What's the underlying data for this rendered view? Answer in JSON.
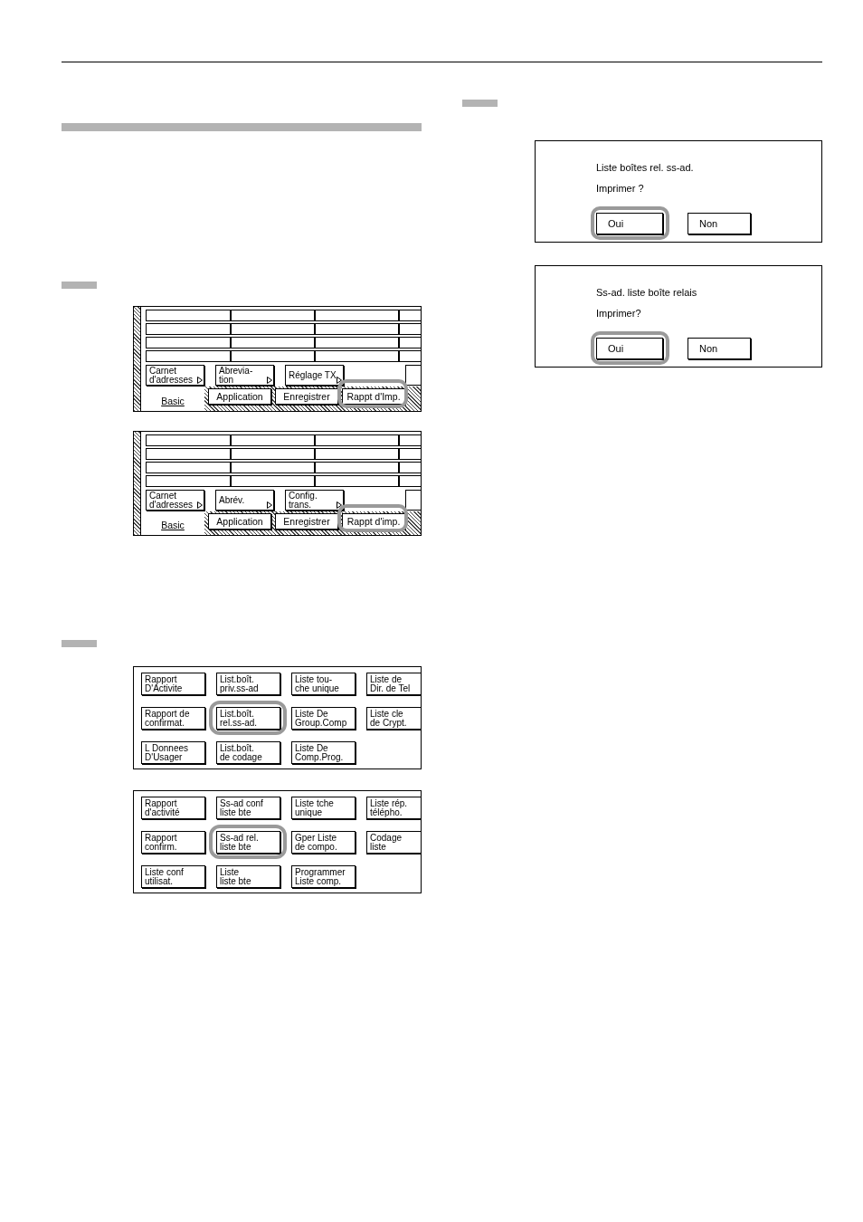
{
  "left_column": {
    "panels": [
      {
        "buttons": [
          {
            "kind": "menu",
            "label": "Carnet\nd'adresses"
          },
          {
            "kind": "menu",
            "label": "Abrevia-\ntion"
          },
          {
            "kind": "menu",
            "label": "Réglage TX"
          },
          {
            "kind": "clipped"
          }
        ],
        "tabs": [
          {
            "label": "Basic",
            "selected": true,
            "highlighted": false
          },
          {
            "label": "Application",
            "selected": false,
            "highlighted": false
          },
          {
            "label": "Enregistrer",
            "selected": false,
            "highlighted": false
          },
          {
            "label": "Rappt d'Imp.",
            "selected": false,
            "highlighted": true
          }
        ]
      },
      {
        "buttons": [
          {
            "kind": "menu",
            "label": "Carnet\nd'adresses"
          },
          {
            "kind": "menu",
            "label": "Abrév."
          },
          {
            "kind": "menu",
            "label": "Config.\ntrans."
          },
          {
            "kind": "clipped"
          }
        ],
        "tabs": [
          {
            "label": "Basic",
            "selected": true,
            "highlighted": false
          },
          {
            "label": "Application",
            "selected": false,
            "highlighted": false
          },
          {
            "label": "Enregistrer",
            "selected": false,
            "highlighted": false
          },
          {
            "label": "Rappt d'imp.",
            "selected": false,
            "highlighted": true
          }
        ]
      }
    ],
    "report_grids": [
      {
        "buttons": [
          {
            "label": "Rapport\nD'Activite",
            "highlighted": false
          },
          {
            "label": "List.boît.\npriv.ss-ad",
            "highlighted": false
          },
          {
            "label": "Liste tou-\nche unique",
            "highlighted": false
          },
          {
            "label": "Liste de\nDir. de Tel",
            "highlighted": false
          },
          {
            "label": "Rapport de\nconfirmat.",
            "highlighted": false
          },
          {
            "label": "List.boît.\nrel.ss-ad.",
            "highlighted": true
          },
          {
            "label": "Liste De\nGroup.Comp",
            "highlighted": false
          },
          {
            "label": "Liste cle\nde Crypt.",
            "highlighted": false
          },
          {
            "label": "L Donnees\nD'Usager",
            "highlighted": false
          },
          {
            "label": "List.boît.\nde codage",
            "highlighted": false
          },
          {
            "label": "Liste De\nComp.Prog.",
            "highlighted": false
          }
        ]
      },
      {
        "buttons": [
          {
            "label": "Rapport\nd'activité",
            "highlighted": false
          },
          {
            "label": "Ss-ad conf\nliste bte",
            "highlighted": false
          },
          {
            "label": "Liste tche\nunique",
            "highlighted": false
          },
          {
            "label": "Liste rép.\ntélépho.",
            "highlighted": false
          },
          {
            "label": "Rapport\nconfirm.",
            "highlighted": false
          },
          {
            "label": "Ss-ad rel.\nliste bte",
            "highlighted": true
          },
          {
            "label": "Gper Liste\nde compo.",
            "highlighted": false
          },
          {
            "label": "Codage\nliste",
            "highlighted": false
          },
          {
            "label": "Liste conf\nutilisat.",
            "highlighted": false
          },
          {
            "label": "Liste\nliste bte",
            "highlighted": false
          },
          {
            "label": "Programmer\nListe comp.",
            "highlighted": false
          }
        ]
      }
    ]
  },
  "right_column": {
    "dialogs": [
      {
        "message": "Liste boîtes rel. ss-ad.",
        "prompt": "Imprimer ?",
        "buttons": [
          {
            "label": "Oui",
            "highlighted": true
          },
          {
            "label": "Non",
            "highlighted": false
          }
        ]
      },
      {
        "message": "Ss-ad. liste boîte relais",
        "prompt": "Imprimer?",
        "buttons": [
          {
            "label": "Oui",
            "highlighted": true
          },
          {
            "label": "Non",
            "highlighted": false
          }
        ]
      }
    ]
  }
}
